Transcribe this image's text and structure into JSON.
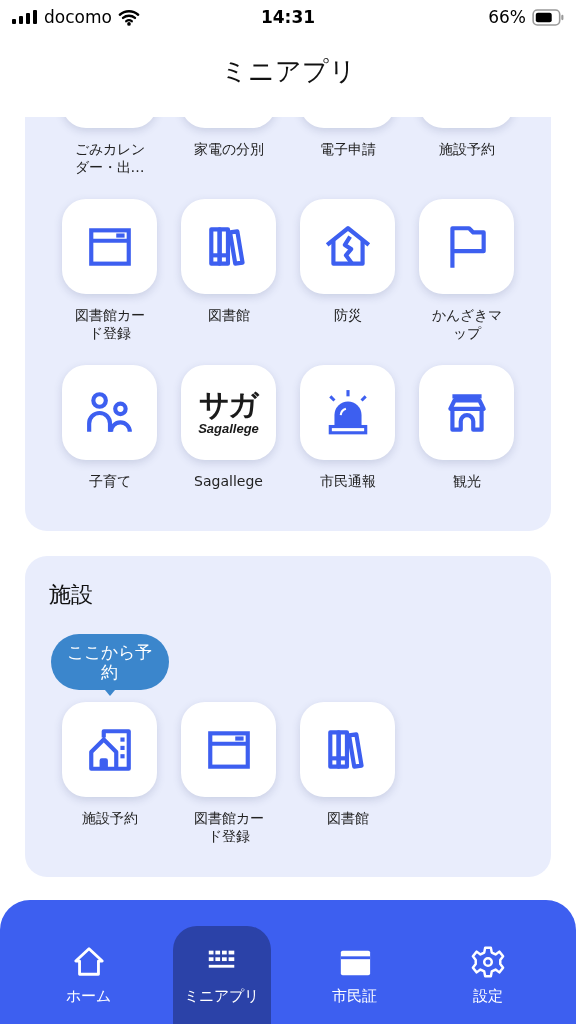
{
  "status_bar": {
    "carrier": "docomo",
    "time": "14:31",
    "battery": "66%"
  },
  "header": {
    "title": "ミニアプリ"
  },
  "sections": [
    {
      "apps": [
        {
          "kind": "hidden",
          "label": "ごみカレンダー・出…"
        },
        {
          "kind": "hidden",
          "label": "家電の分別"
        },
        {
          "kind": "hidden",
          "label": "電子申請"
        },
        {
          "kind": "hidden",
          "label": "施設予約"
        },
        {
          "kind": "card",
          "label": "図書館カード登録"
        },
        {
          "kind": "books",
          "label": "図書館"
        },
        {
          "kind": "disaster",
          "label": "防災"
        },
        {
          "kind": "flag",
          "label": "かんざきマップ"
        },
        {
          "kind": "family",
          "label": "子育て"
        },
        {
          "kind": "logo",
          "label": "Sagallege",
          "logo": {
            "main": "サガ",
            "sub": "Sagallege"
          }
        },
        {
          "kind": "alert",
          "label": "市民通報"
        },
        {
          "kind": "gate",
          "label": "観光"
        }
      ]
    },
    {
      "title": "施設",
      "apps": [
        {
          "kind": "building",
          "label": "施設予約",
          "tooltip": "ここから予約"
        },
        {
          "kind": "card",
          "label": "図書館カード登録"
        },
        {
          "kind": "books",
          "label": "図書館"
        }
      ]
    }
  ],
  "tabs": [
    {
      "kind": "home",
      "label": "ホーム",
      "selected": false
    },
    {
      "kind": "grid",
      "label": "ミニアプリ",
      "selected": true
    },
    {
      "kind": "idcard",
      "label": "市民証",
      "selected": false
    },
    {
      "kind": "gear",
      "label": "設定",
      "selected": false
    }
  ]
}
